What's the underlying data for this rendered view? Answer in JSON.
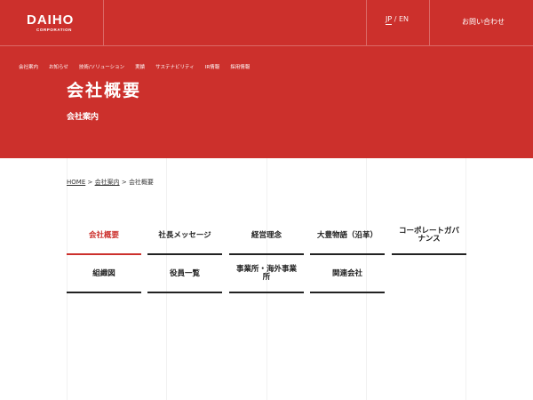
{
  "header": {
    "logo_main": "DAIHO",
    "logo_sub": "CORPORATION",
    "lang_jp": "JP",
    "lang_sep": "/",
    "lang_en": "EN",
    "contact_label": "お問い合わせ"
  },
  "topnav": {
    "items": [
      {
        "label": "会社案内"
      },
      {
        "label": "お知らせ"
      },
      {
        "label": "技術/ソリューション"
      },
      {
        "label": "実績"
      },
      {
        "label": "サステナビリティ"
      },
      {
        "label": "IR情報"
      },
      {
        "label": "採用情報"
      }
    ]
  },
  "hero": {
    "title": "会社概要",
    "subtitle": "会社案内"
  },
  "breadcrumb": {
    "home": "HOME",
    "sep1": ">",
    "section": "会社案内",
    "sep2": ">",
    "current": "会社概要"
  },
  "subnav": {
    "items": [
      {
        "label": "会社概要",
        "active": true
      },
      {
        "label": "社長メッセージ"
      },
      {
        "label": "経営理念"
      },
      {
        "label": "大豊物語（沿革）"
      },
      {
        "label": "コーポレートガバナンス"
      },
      {
        "label": "組織図"
      },
      {
        "label": "役員一覧"
      },
      {
        "label": "事業所・海外事業所"
      },
      {
        "label": "関連会社"
      }
    ]
  },
  "colors": {
    "brand_red": "#cc302c",
    "text_dark": "#222222"
  }
}
